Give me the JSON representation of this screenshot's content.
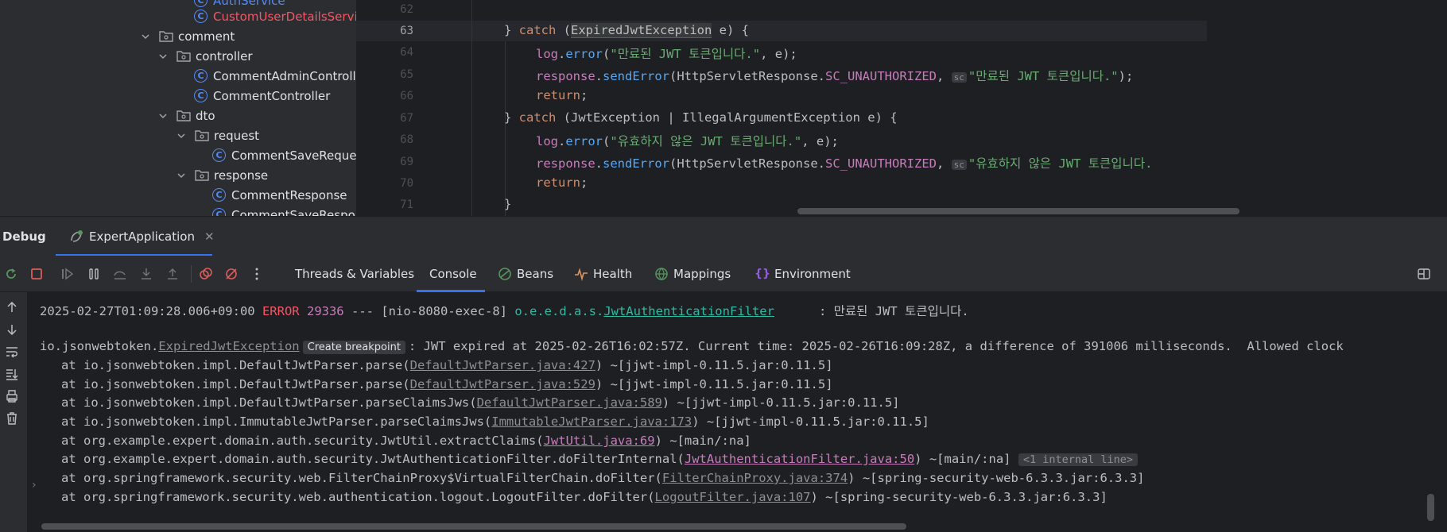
{
  "project_tree": {
    "items": [
      {
        "label": "AuthService",
        "kind": "class",
        "state": "partial"
      },
      {
        "label": "CustomUserDetailsService",
        "kind": "class",
        "state": "error"
      },
      {
        "label": "comment",
        "kind": "package"
      },
      {
        "label": "controller",
        "kind": "package"
      },
      {
        "label": "CommentAdminController",
        "kind": "class"
      },
      {
        "label": "CommentController",
        "kind": "class"
      },
      {
        "label": "dto",
        "kind": "package"
      },
      {
        "label": "request",
        "kind": "package"
      },
      {
        "label": "CommentSaveRequest",
        "kind": "class"
      },
      {
        "label": "response",
        "kind": "package"
      },
      {
        "label": "CommentResponse",
        "kind": "class"
      },
      {
        "label": "CommentSaveResponse",
        "kind": "class"
      }
    ]
  },
  "editor": {
    "line_numbers": [
      "62",
      "63",
      "64",
      "65",
      "66",
      "67",
      "68",
      "69",
      "70",
      "71"
    ],
    "current_line": "63",
    "lines": {
      "l63": {
        "close": "} ",
        "kw": "catch",
        "open": " (",
        "exc": "ExpiredJwtException",
        "rest": " e) {"
      },
      "l64": {
        "obj": "log",
        "dot": ".",
        "fn": "error",
        "open": "(",
        "str": "\"만료된 JWT 토큰입니다.\"",
        "rest": ", e);"
      },
      "l65": {
        "obj": "response",
        "dot": ".",
        "fn": "sendError",
        "open": "(",
        "cls": "HttpServletResponse",
        "dot2": ".",
        "fld": "SC_UNAUTHORIZED",
        "comma": ", ",
        "hint": "sc",
        "str": "\"만료된 JWT 토큰입니다.\"",
        "rest": ");"
      },
      "l66": {
        "kw": "return",
        "rest": ";"
      },
      "l67": {
        "close": "} ",
        "kw": "catch",
        "rest": " (JwtException | IllegalArgumentException e) {"
      },
      "l68": {
        "obj": "log",
        "dot": ".",
        "fn": "error",
        "open": "(",
        "str": "\"유효하지 않은 JWT 토큰입니다.\"",
        "rest": ", e);"
      },
      "l69": {
        "obj": "response",
        "dot": ".",
        "fn": "sendError",
        "open": "(",
        "cls": "HttpServletResponse",
        "dot2": ".",
        "fld": "SC_UNAUTHORIZED",
        "comma": ", ",
        "hint": "sc",
        "str": "\"유효하지 않은 JWT 토큰입니다."
      },
      "l70": {
        "kw": "return",
        "rest": ";"
      },
      "l71": {
        "close": "}"
      }
    }
  },
  "debug": {
    "title": "Debug",
    "run_tab": {
      "label": "ExpertApplication",
      "close": "✕"
    },
    "tabs": [
      {
        "label": "Threads & Variables",
        "icon": "none"
      },
      {
        "label": "Console",
        "icon": "none",
        "active": true
      },
      {
        "label": "Beans",
        "icon": "beans-icon"
      },
      {
        "label": "Health",
        "icon": "health-icon"
      },
      {
        "label": "Mappings",
        "icon": "mappings-icon"
      },
      {
        "label": "Environment",
        "icon": "environment-icon"
      }
    ]
  },
  "console": {
    "log_line": {
      "timestamp": "2025-02-27T01:09:28.006+09:00",
      "level": "ERROR",
      "pid": "29336",
      "sep": "---",
      "thread": "[nio-8080-exec-8]",
      "logger_prefix": "o.e.e.d.a.s.",
      "logger_class": "JwtAuthenticationFilter",
      "message": ": 만료된 JWT 토큰입니다."
    },
    "exception": {
      "pkg": "io.jsonwebtoken.",
      "cls": "ExpiredJwtException",
      "badge": "Create breakpoint",
      "message": ": JWT expired at 2025-02-26T16:02:57Z. Current time: 2025-02-26T16:09:28Z, a difference of 391006 milliseconds.  Allowed clock"
    },
    "stack": [
      {
        "at": "at io.jsonwebtoken.impl.DefaultJwtParser.parse(",
        "link": "DefaultJwtParser.java:427",
        "tail": ") ~[jjwt-impl-0.11.5.jar:0.11.5]",
        "style": "lib"
      },
      {
        "at": "at io.jsonwebtoken.impl.DefaultJwtParser.parse(",
        "link": "DefaultJwtParser.java:529",
        "tail": ") ~[jjwt-impl-0.11.5.jar:0.11.5]",
        "style": "lib"
      },
      {
        "at": "at io.jsonwebtoken.impl.DefaultJwtParser.parseClaimsJws(",
        "link": "DefaultJwtParser.java:589",
        "tail": ") ~[jjwt-impl-0.11.5.jar:0.11.5]",
        "style": "lib"
      },
      {
        "at": "at io.jsonwebtoken.impl.ImmutableJwtParser.parseClaimsJws(",
        "link": "ImmutableJwtParser.java:173",
        "tail": ") ~[jjwt-impl-0.11.5.jar:0.11.5]",
        "style": "lib"
      },
      {
        "at": "at org.example.expert.domain.auth.security.JwtUtil.extractClaims(",
        "link": "JwtUtil.java:69",
        "tail": ") ~[main/:na]",
        "style": "own"
      },
      {
        "at": "at org.example.expert.domain.auth.security.JwtAuthenticationFilter.doFilterInternal(",
        "link": "JwtAuthenticationFilter.java:50",
        "tail": ") ~[main/:na]",
        "internal": "<1 internal line>",
        "style": "own"
      },
      {
        "at": "at org.springframework.security.web.FilterChainProxy$VirtualFilterChain.doFilter(",
        "link": "FilterChainProxy.java:374",
        "tail": ") ~[spring-security-web-6.3.3.jar:6.3.3]",
        "style": "lib"
      },
      {
        "at": "at org.springframework.security.web.authentication.logout.LogoutFilter.doFilter(",
        "link": "LogoutFilter.java:107",
        "tail": ") ~[spring-security-web-6.3.3.jar:6.3.3]",
        "style": "lib"
      }
    ]
  },
  "colors": {
    "error": "#f75464",
    "accent": "#3574f0",
    "string": "#6aab73",
    "keyword": "#cf8e6d"
  }
}
